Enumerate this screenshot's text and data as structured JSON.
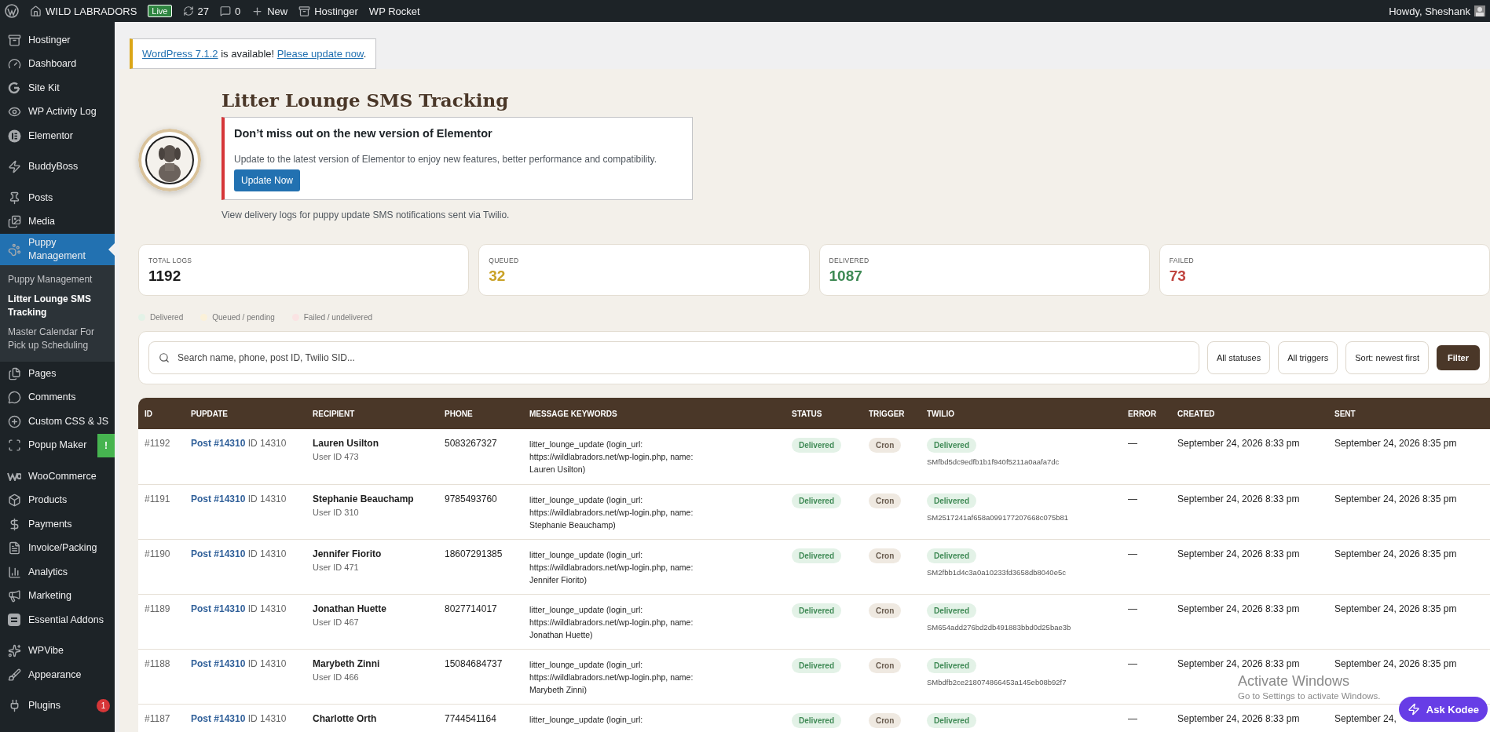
{
  "admin_bar": {
    "site": "WILD LABRADORS",
    "live_badge": "Live",
    "updates": "27",
    "comments": "0",
    "new": "New",
    "hostinger": "Hostinger",
    "wp_rocket": "WP Rocket",
    "greeting": "Howdy, Sheshank"
  },
  "sidebar": {
    "groups": [
      [
        {
          "label": "Hostinger",
          "selected": false
        },
        {
          "label": "Dashboard",
          "selected": false
        },
        {
          "label": "Site Kit",
          "selected": false
        },
        {
          "label": "WP Activity Log",
          "selected": false
        },
        {
          "label": "Elementor",
          "selected": false
        }
      ],
      [
        {
          "label": "BuddyBoss",
          "selected": false
        }
      ],
      [
        {
          "label": "Posts",
          "selected": false
        },
        {
          "label": "Media",
          "selected": false
        },
        {
          "label": "Puppy Management",
          "selected": true,
          "children": [
            {
              "label": "Puppy Management",
              "selected": false
            },
            {
              "label": "Litter Lounge SMS Tracking",
              "selected": true
            },
            {
              "label": "Master Calendar For Pick up Scheduling",
              "selected": false
            }
          ]
        },
        {
          "label": "Pages",
          "selected": false
        },
        {
          "label": "Comments",
          "selected": false
        },
        {
          "label": "Custom CSS & JS",
          "selected": false
        },
        {
          "label": "Popup Maker",
          "selected": false,
          "badge": "!"
        }
      ],
      [
        {
          "label": "WooCommerce",
          "selected": false
        },
        {
          "label": "Products",
          "selected": false
        },
        {
          "label": "Payments",
          "selected": false
        },
        {
          "label": "Invoice/Packing",
          "selected": false
        },
        {
          "label": "Analytics",
          "selected": false
        },
        {
          "label": "Marketing",
          "selected": false
        },
        {
          "label": "Essential Addons",
          "selected": false
        }
      ],
      [
        {
          "label": "WPVibe",
          "selected": false
        },
        {
          "label": "Appearance",
          "selected": false
        }
      ],
      [
        {
          "label": "Plugins",
          "selected": false,
          "count": "1"
        }
      ]
    ]
  },
  "update_notice": {
    "link": "WordPress 7.1.2",
    "text": " is available! ",
    "action": "Please update now",
    "end": "."
  },
  "page": {
    "title": "Litter Lounge SMS Tracking",
    "subtitle": "View delivery logs for puppy update SMS notifications sent via Twilio."
  },
  "elementor_notice": {
    "title": "Don’t miss out on the new version of Elementor",
    "text": "Update to the latest version of Elementor to enjoy new features, better performance and compatibility.",
    "button": "Update Now"
  },
  "stats": [
    {
      "label": "TOTAL LOGS",
      "value": "1192",
      "color": "#1d1d1d"
    },
    {
      "label": "QUEUED",
      "value": "32",
      "color": "#c9a227"
    },
    {
      "label": "DELIVERED",
      "value": "1087",
      "color": "#3f8a55"
    },
    {
      "label": "FAILED",
      "value": "73",
      "color": "#c0443f"
    }
  ],
  "legend": [
    {
      "label": "Delivered",
      "color": "#e3f2e7"
    },
    {
      "label": "Queued / pending",
      "color": "#fbf1d9"
    },
    {
      "label": "Failed / undelivered",
      "color": "#fae3e3"
    }
  ],
  "filters": {
    "search_placeholder": "Search name, phone, post ID, Twilio SID...",
    "status": "All statuses",
    "trigger": "All triggers",
    "sort": "Sort: newest first",
    "button": "Filter"
  },
  "table": {
    "columns": [
      "ID",
      "PUPDATE",
      "RECIPIENT",
      "PHONE",
      "MESSAGE KEYWORDS",
      "STATUS",
      "TRIGGER",
      "TWILIO",
      "ERROR",
      "CREATED",
      "SENT"
    ],
    "rows": [
      {
        "id": "#1192",
        "post": "Post #14310",
        "post_id": "ID 14310",
        "name": "Lauren Usilton",
        "user": "User ID 473",
        "phone": "5083267327",
        "message": "litter_lounge_update (login_url: https://wildlabradors.net/wp-login.php, name: Lauren Usilton)",
        "status": "Delivered",
        "trigger": "Cron",
        "twilio_status": "Delivered",
        "sid": "SMfbd5dc9edfb1b1f940f5211a0aafa7dc",
        "error": "—",
        "created": "September 24, 2026 8:33 pm",
        "sent": "September 24, 2026 8:35 pm"
      },
      {
        "id": "#1191",
        "post": "Post #14310",
        "post_id": "ID 14310",
        "name": "Stephanie Beauchamp",
        "user": "User ID 310",
        "phone": "9785493760",
        "message": "litter_lounge_update (login_url: https://wildlabradors.net/wp-login.php, name: Stephanie Beauchamp)",
        "status": "Delivered",
        "trigger": "Cron",
        "twilio_status": "Delivered",
        "sid": "SM2517241af658a099177207668c075b81",
        "error": "—",
        "created": "September 24, 2026 8:33 pm",
        "sent": "September 24, 2026 8:35 pm"
      },
      {
        "id": "#1190",
        "post": "Post #14310",
        "post_id": "ID 14310",
        "name": "Jennifer Fiorito",
        "user": "User ID 471",
        "phone": "18607291385",
        "message": "litter_lounge_update (login_url: https://wildlabradors.net/wp-login.php, name: Jennifer Fiorito)",
        "status": "Delivered",
        "trigger": "Cron",
        "twilio_status": "Delivered",
        "sid": "SM2fbb1d4c3a0a10233fd3658db8040e5c",
        "error": "—",
        "created": "September 24, 2026 8:33 pm",
        "sent": "September 24, 2026 8:35 pm"
      },
      {
        "id": "#1189",
        "post": "Post #14310",
        "post_id": "ID 14310",
        "name": "Jonathan Huette",
        "user": "User ID 467",
        "phone": "8027714017",
        "message": "litter_lounge_update (login_url: https://wildlabradors.net/wp-login.php, name: Jonathan Huette)",
        "status": "Delivered",
        "trigger": "Cron",
        "twilio_status": "Delivered",
        "sid": "SM654add276bd2db491883bbd0d25bae3b",
        "error": "—",
        "created": "September 24, 2026 8:33 pm",
        "sent": "September 24, 2026 8:35 pm"
      },
      {
        "id": "#1188",
        "post": "Post #14310",
        "post_id": "ID 14310",
        "name": "Marybeth Zinni",
        "user": "User ID 466",
        "phone": "15084684737",
        "message": "litter_lounge_update (login_url: https://wildlabradors.net/wp-login.php, name: Marybeth Zinni)",
        "status": "Delivered",
        "trigger": "Cron",
        "twilio_status": "Delivered",
        "sid": "SMbdfb2ce218074866453a145eb08b92f7",
        "error": "—",
        "created": "September 24, 2026 8:33 pm",
        "sent": "September 24, 2026 8:35 pm"
      },
      {
        "id": "#1187",
        "post": "Post #14310",
        "post_id": "ID 14310",
        "name": "Charlotte Orth",
        "phone": "7744541164",
        "message": "litter_lounge_update (login_url:",
        "status": "Delivered",
        "trigger": "Cron",
        "twilio_status": "Delivered",
        "error": "—",
        "created": "September 24, 2026 8:33 pm",
        "sent": "September 24,"
      }
    ]
  },
  "os_notice": {
    "title": "Activate Windows",
    "text": "Go to Settings to activate Windows."
  },
  "assistant_button": "Ask Kodee"
}
